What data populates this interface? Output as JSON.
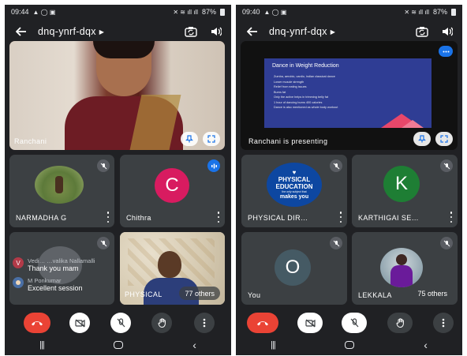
{
  "left": {
    "status": {
      "time": "09:44",
      "battery": "87%"
    },
    "meeting_code": "dnq-ynrf-dqx",
    "main_tile": {
      "name": "Ranchani"
    },
    "tiles": [
      {
        "name": "NARMADHA  G"
      },
      {
        "name": "Chithra",
        "initial": "C",
        "color": "#d81b60"
      },
      {
        "name": "PHYSICAL"
      }
    ],
    "others_count": "77 others",
    "chat": [
      {
        "avatar": "V",
        "sender": "Vedi… …valika Nallamalli",
        "message": "Thank you mam"
      },
      {
        "avatar": "",
        "sender": "M Ponkumar",
        "message": "Excellent session"
      }
    ]
  },
  "right": {
    "status": {
      "time": "09:40",
      "battery": "87%"
    },
    "meeting_code": "dnq-ynrf-dqx",
    "presenting_label": "Ranchani is presenting",
    "slide": {
      "title": "Dance in Weight Reduction",
      "bullets": [
        "Zumba, aerobic, cardio, indian classical dance",
        "Lower muscle strength",
        "Relief from eating issues",
        "Burns fat",
        "Only the active helps in trimming belly fat",
        "1 hour of dancing burns 400 calories",
        "Dance is also mentioned as whole body workout"
      ]
    },
    "tiles": [
      {
        "name": "PHYSICAL DIR…",
        "logo_lines": [
          "PHYSICAL",
          "EDUCATION",
          "the only subject that",
          "makes you"
        ]
      },
      {
        "name": "KARTHIGAI SE…",
        "initial": "K",
        "color": "#1e7e34"
      },
      {
        "name": "You",
        "initial": "O",
        "color": "#455a64"
      },
      {
        "name": "LEKKALA"
      }
    ],
    "others_count": "75 others"
  },
  "colors": {
    "end_call": "#ea4335",
    "tile_bg": "#3c4043",
    "app_bg": "#202124",
    "slide_bg": "#2f3d94"
  }
}
